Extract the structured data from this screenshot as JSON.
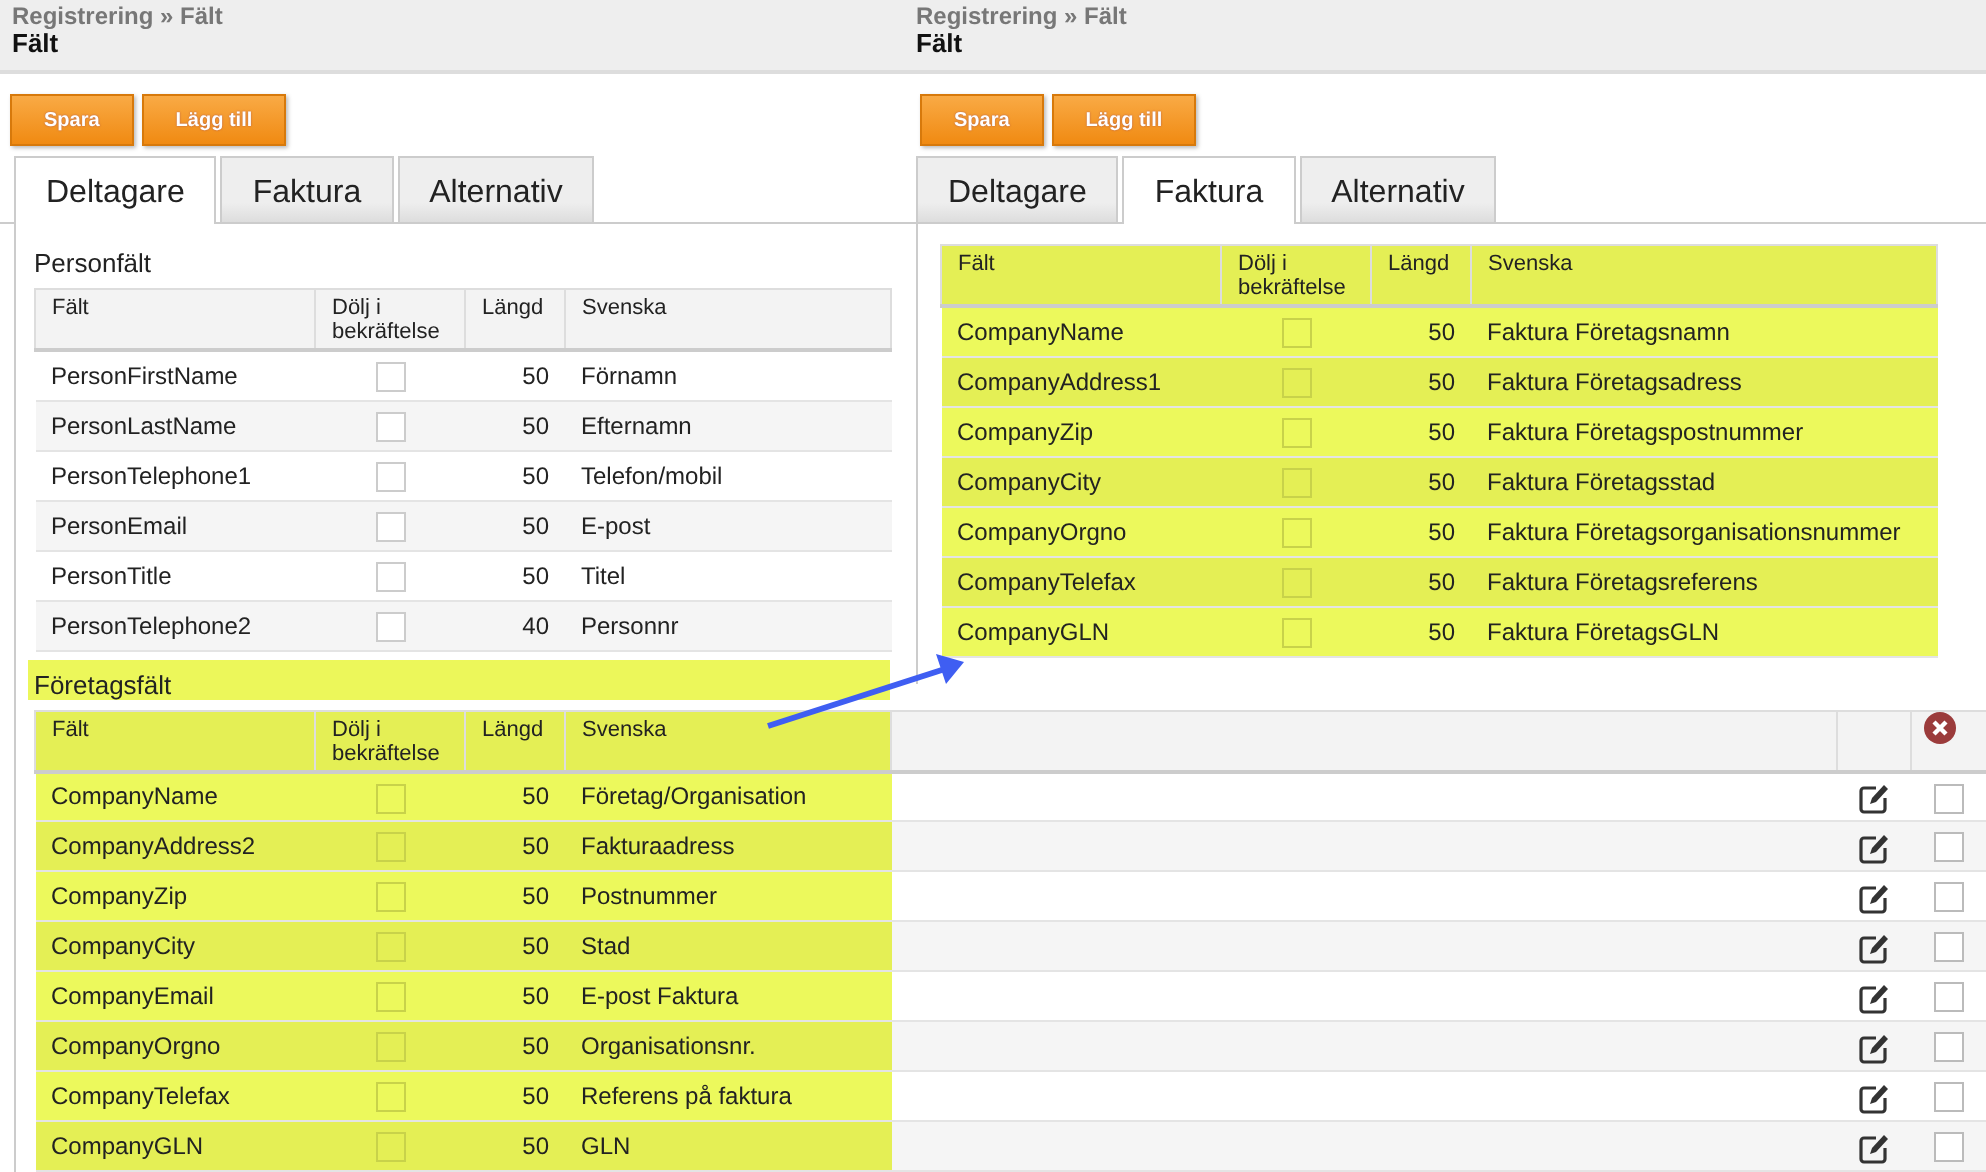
{
  "left_screen": {
    "breadcrumb": "Registrering » Fält",
    "title": "Fält",
    "buttons": [
      "Spara",
      "Lägg till"
    ],
    "tabs": [
      {
        "label": "Deltagare",
        "selected": true
      },
      {
        "label": "Faktura",
        "selected": false
      },
      {
        "label": "Alternativ",
        "selected": false
      }
    ],
    "sections": [
      {
        "title": "Personfält",
        "highlighted": false,
        "columns": [
          "Fält",
          "Dölj i bekräftelse",
          "Längd",
          "Svenska"
        ],
        "rows": [
          {
            "field": "PersonFirstName",
            "hidden": false,
            "length": "50",
            "label": "Förnamn"
          },
          {
            "field": "PersonLastName",
            "hidden": false,
            "length": "50",
            "label": "Efternamn"
          },
          {
            "field": "PersonTelephone1",
            "hidden": false,
            "length": "50",
            "label": "Telefon/mobil"
          },
          {
            "field": "PersonEmail",
            "hidden": false,
            "length": "50",
            "label": "E-post"
          },
          {
            "field": "PersonTitle",
            "hidden": false,
            "length": "50",
            "label": "Titel"
          },
          {
            "field": "PersonTelephone2",
            "hidden": false,
            "length": "40",
            "label": "Personnr"
          }
        ]
      },
      {
        "title": "Företagsfält",
        "highlighted": true,
        "columns": [
          "Fält",
          "Dölj i bekräftelse",
          "Längd",
          "Svenska"
        ],
        "rows": [
          {
            "field": "CompanyName",
            "hidden": false,
            "length": "50",
            "label": "Företag/Organisation",
            "selected": false
          },
          {
            "field": "CompanyAddress2",
            "hidden": false,
            "length": "50",
            "label": "Fakturaadress",
            "selected": false
          },
          {
            "field": "CompanyZip",
            "hidden": false,
            "length": "50",
            "label": "Postnummer",
            "selected": false
          },
          {
            "field": "CompanyCity",
            "hidden": false,
            "length": "50",
            "label": "Stad",
            "selected": false
          },
          {
            "field": "CompanyEmail",
            "hidden": false,
            "length": "50",
            "label": "E-post Faktura",
            "selected": false
          },
          {
            "field": "CompanyOrgno",
            "hidden": false,
            "length": "50",
            "label": "Organisationsnr.",
            "selected": false
          },
          {
            "field": "CompanyTelefax",
            "hidden": false,
            "length": "50",
            "label": "Referens på faktura",
            "selected": false
          },
          {
            "field": "CompanyGLN",
            "hidden": false,
            "length": "50",
            "label": "GLN",
            "selected": false
          }
        ]
      }
    ]
  },
  "right_screen": {
    "breadcrumb": "Registrering » Fält",
    "title": "Fält",
    "buttons": [
      "Spara",
      "Lägg till"
    ],
    "tabs": [
      {
        "label": "Deltagare",
        "selected": false
      },
      {
        "label": "Faktura",
        "selected": true
      },
      {
        "label": "Alternativ",
        "selected": false
      }
    ],
    "sections": [
      {
        "highlighted": true,
        "columns": [
          "Fält",
          "Dölj i bekräftelse",
          "Längd",
          "Svenska"
        ],
        "rows": [
          {
            "field": "CompanyName",
            "hidden": false,
            "length": "50",
            "label": "Faktura Företagsnamn"
          },
          {
            "field": "CompanyAddress1",
            "hidden": false,
            "length": "50",
            "label": "Faktura Företagsadress"
          },
          {
            "field": "CompanyZip",
            "hidden": false,
            "length": "50",
            "label": "Faktura Företagspostnummer"
          },
          {
            "field": "CompanyCity",
            "hidden": false,
            "length": "50",
            "label": "Faktura Företagsstad"
          },
          {
            "field": "CompanyOrgno",
            "hidden": false,
            "length": "50",
            "label": "Faktura Företagsorganisationsnummer"
          },
          {
            "field": "CompanyTelefax",
            "hidden": false,
            "length": "50",
            "label": "Faktura Företagsreferens"
          },
          {
            "field": "CompanyGLN",
            "hidden": false,
            "length": "50",
            "label": "Faktura FöretagsGLN"
          }
        ]
      }
    ]
  }
}
